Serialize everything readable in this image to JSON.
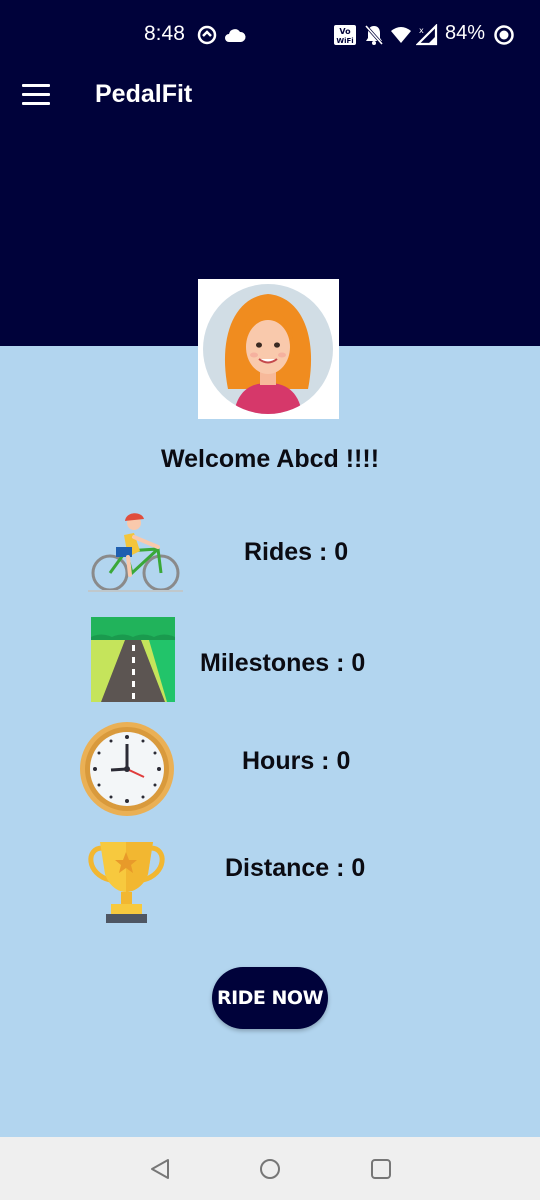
{
  "status_bar": {
    "time": "8:48",
    "battery": "84%",
    "icons": [
      "vpn-icon",
      "cloud-icon",
      "vowifi-icon",
      "mute-icon",
      "wifi-icon",
      "signal-icon",
      "battery-icon"
    ]
  },
  "app_bar": {
    "title": "PedalFit",
    "menu_icon": "hamburger-menu-icon"
  },
  "profile": {
    "avatar": "woman-avatar",
    "welcome": "Welcome Abcd !!!!"
  },
  "stats": [
    {
      "icon": "cyclist-icon",
      "label": "Rides : 0"
    },
    {
      "icon": "road-icon",
      "label": "Milestones : 0"
    },
    {
      "icon": "clock-icon",
      "label": "Hours : 0"
    },
    {
      "icon": "trophy-icon",
      "label": "Distance : 0"
    }
  ],
  "ride_button": "RIDE NOW",
  "nav": [
    "back-icon",
    "home-icon",
    "recents-icon"
  ],
  "colors": {
    "header": "#00023a",
    "background": "#b2d5ef",
    "button": "#00023a",
    "nav_bar": "#efefef"
  }
}
